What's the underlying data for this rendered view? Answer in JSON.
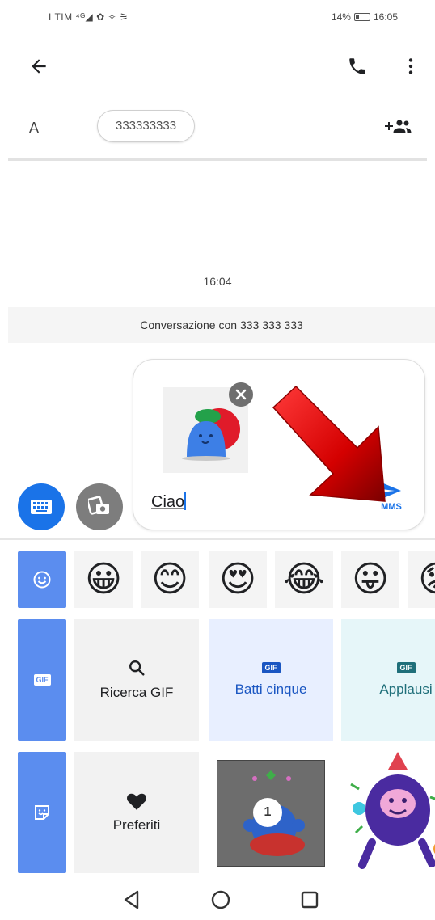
{
  "status_bar": {
    "left": "I TIM ⁴ᴳ◢ ✿ ✧ ⚞",
    "battery_percent": "14%",
    "time": "16:05"
  },
  "toolbar": {
    "back_icon": "arrow-left-icon",
    "call_icon": "phone-icon",
    "more_icon": "more-vert-icon"
  },
  "recipient": {
    "to_label": "A",
    "chip_text": "333333333",
    "add_icon": "add-people-icon"
  },
  "conversation": {
    "timestamp": "16:04",
    "banner": "Conversazione con 333 333 333"
  },
  "compose": {
    "message_text": "Ciao",
    "send_label": "MMS",
    "send_icon": "send-icon",
    "remove_icon": "close-icon"
  },
  "panel": {
    "emojis": [
      "😀",
      "😊",
      "😍",
      "😂",
      "😛",
      "😟"
    ],
    "gif_search_label": "Ricerca GIF",
    "gif_five_label": "Batti cinque",
    "gif_applause_label": "Applausi",
    "gif_badge": "GIF",
    "favorites_label": "Preferiti",
    "sticker_badge": "1"
  },
  "colors": {
    "accent": "#1a73e8",
    "side_tab": "#5b8def",
    "arrow": "#d40000"
  }
}
